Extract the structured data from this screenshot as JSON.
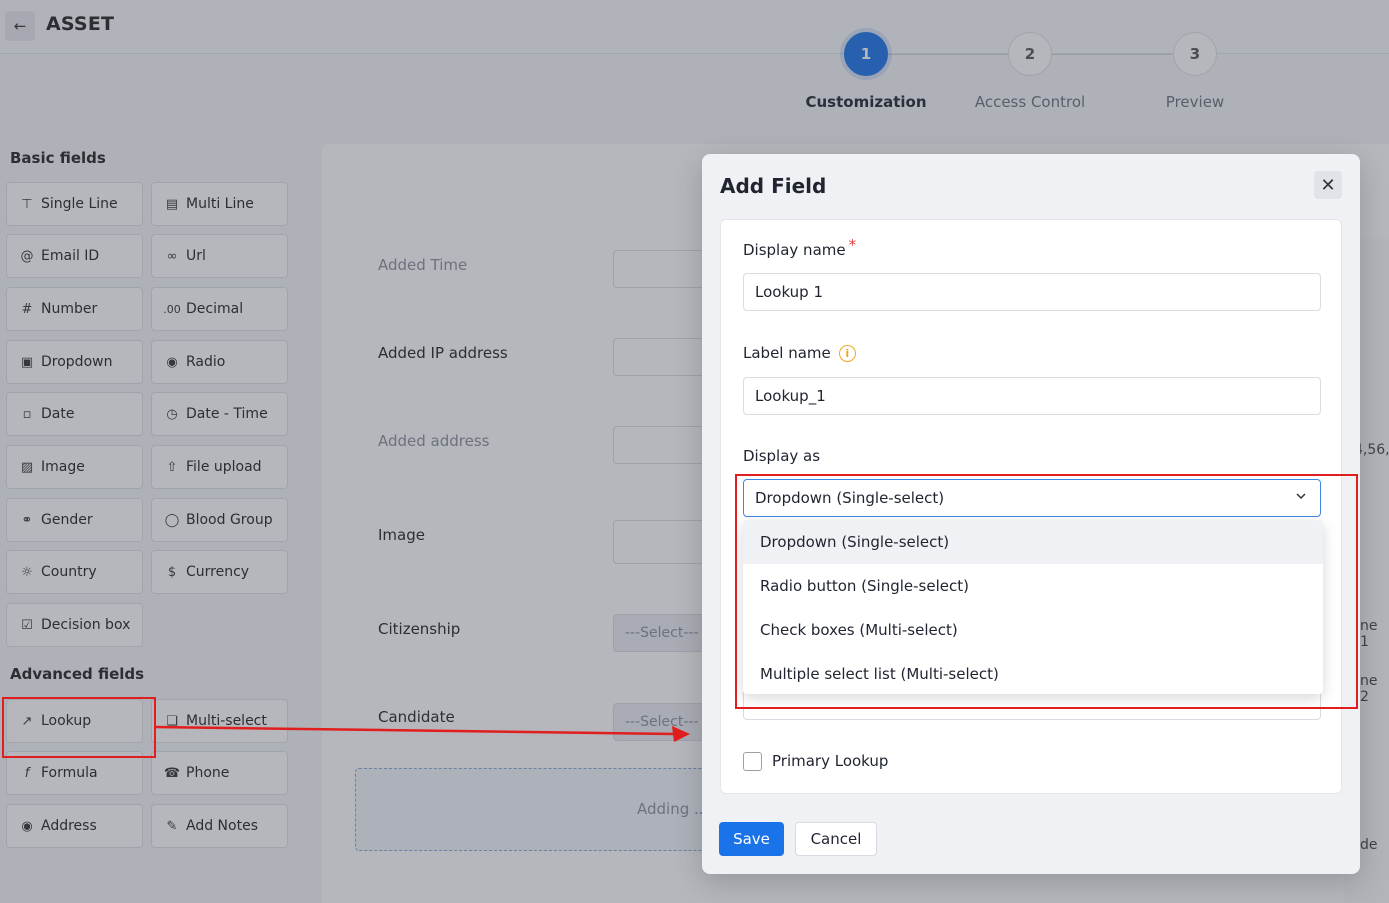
{
  "header": {
    "back_icon": "arrow-left-icon",
    "title": "ASSET"
  },
  "stepper": {
    "steps": [
      {
        "number": "1",
        "label": "Customization"
      },
      {
        "number": "2",
        "label": "Access Control"
      },
      {
        "number": "3",
        "label": "Preview"
      }
    ],
    "active_step": 1
  },
  "sidebar": {
    "basic_title": "Basic fields",
    "basic_fields": [
      {
        "label": "Single Line",
        "icon": "single-line-icon"
      },
      {
        "label": "Multi Line",
        "icon": "multi-line-icon"
      },
      {
        "label": "Email ID",
        "icon": "at-icon"
      },
      {
        "label": "Url",
        "icon": "link-icon"
      },
      {
        "label": "Number",
        "icon": "hash-icon"
      },
      {
        "label": "Decimal",
        "icon": "decimal-icon"
      },
      {
        "label": "Dropdown",
        "icon": "dropdown-icon"
      },
      {
        "label": "Radio",
        "icon": "radio-icon"
      },
      {
        "label": "Date",
        "icon": "calendar-icon"
      },
      {
        "label": "Date - Time",
        "icon": "calendar-clock-icon"
      },
      {
        "label": "Image",
        "icon": "image-icon"
      },
      {
        "label": "File upload",
        "icon": "file-upload-icon"
      },
      {
        "label": "Gender",
        "icon": "gender-icon"
      },
      {
        "label": "Blood Group",
        "icon": "drop-icon"
      },
      {
        "label": "Country",
        "icon": "globe-icon"
      },
      {
        "label": "Currency",
        "icon": "currency-icon"
      },
      {
        "label": "Decision box",
        "icon": "checkbox-icon"
      }
    ],
    "advanced_title": "Advanced fields",
    "advanced_fields": [
      {
        "label": "Lookup",
        "icon": "lookup-icon"
      },
      {
        "label": "Multi-select",
        "icon": "multi-select-icon"
      },
      {
        "label": "Formula",
        "icon": "formula-icon"
      },
      {
        "label": "Phone",
        "icon": "phone-icon"
      },
      {
        "label": "Address",
        "icon": "location-pin-icon"
      },
      {
        "label": "Add Notes",
        "icon": "notes-icon"
      }
    ]
  },
  "form": {
    "rows": [
      {
        "label": "Added Time",
        "muted": true,
        "value": ""
      },
      {
        "label": "Added IP address",
        "muted": false,
        "value": ""
      },
      {
        "label": "Added address",
        "muted": true,
        "value": ""
      },
      {
        "label": "Image",
        "muted": false,
        "value": ""
      },
      {
        "label": "Citizenship",
        "muted": false,
        "value": "---Select---"
      },
      {
        "label": "Candidate",
        "muted": false,
        "value": "---Select---"
      }
    ],
    "adding_text": "Adding ...",
    "right_edge": [
      "4,56,",
      "ne 1",
      "ne 2",
      "de"
    ]
  },
  "modal": {
    "title": "Add Field",
    "close_icon": "close-icon",
    "display_name_label": "Display name",
    "required_mark": "*",
    "display_name_value": "Lookup 1",
    "label_name_label": "Label name",
    "info_icon": "info-icon",
    "label_name_value": "Lookup_1",
    "display_as_label": "Display as",
    "display_as_value": "Dropdown (Single-select)",
    "display_as_options": [
      "Dropdown (Single-select)",
      "Radio button (Single-select)",
      "Check boxes (Multi-select)",
      "Multiple select list (Multi-select)"
    ],
    "primary_lookup_label": "Primary Lookup",
    "primary_lookup_checked": false,
    "save_label": "Save",
    "cancel_label": "Cancel"
  },
  "colors": {
    "accent": "#1a73e8",
    "annotation": "#e01e1e",
    "required": "#e53935",
    "info": "#f1a820"
  }
}
